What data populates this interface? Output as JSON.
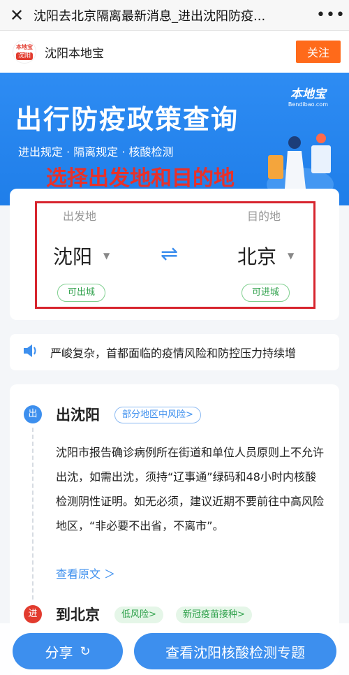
{
  "titlebar": {
    "close_icon": "close-icon",
    "title": "沈阳去北京隔离最新消息_进出沈阳防疫...",
    "more_icon": "more-dots-icon"
  },
  "account": {
    "logo_top": "本地宝",
    "logo_bottom": "沈阳",
    "name": "沈阳本地宝",
    "follow_label": "关注"
  },
  "banner": {
    "title": "出行防疫政策查询",
    "subtitle": "进出规定 · 隔离规定 · 核酸检测",
    "brand": "本地宝",
    "brand_url": "Bendibao.com",
    "hint": "选择出发地和目的地"
  },
  "selector": {
    "from_label": "出发地",
    "from_city": "沈阳",
    "from_status": "可出城",
    "to_label": "目的地",
    "to_city": "北京",
    "to_status": "可进城",
    "swap_icon": "swap-arrows-icon"
  },
  "notice": {
    "icon": "speaker-icon",
    "text": "严峻复杂，首都面临的疫情风险和防控压力持续增"
  },
  "policy": {
    "out_dot": "出",
    "out_title": "出沈阳",
    "out_tag": "部分地区中风险>",
    "out_body": "沈阳市报告确诊病例所在街道和单位人员原则上不允许出沈，如需出沈，须持“辽事通”绿码和48小时内核酸检测阴性证明。如无必须，建议近期不要前往中高风险地区，“非必要不出省，不离市”。",
    "out_more": "查看原文 ＞",
    "in_dot": "进",
    "in_title": "到北京",
    "in_tag1": "低风险>",
    "in_tag2": "新冠疫苗接种>"
  },
  "bottom": {
    "share_label": "分享",
    "share_icon": "refresh-icon",
    "topic_label": "查看沈阳核酸检测专题"
  }
}
